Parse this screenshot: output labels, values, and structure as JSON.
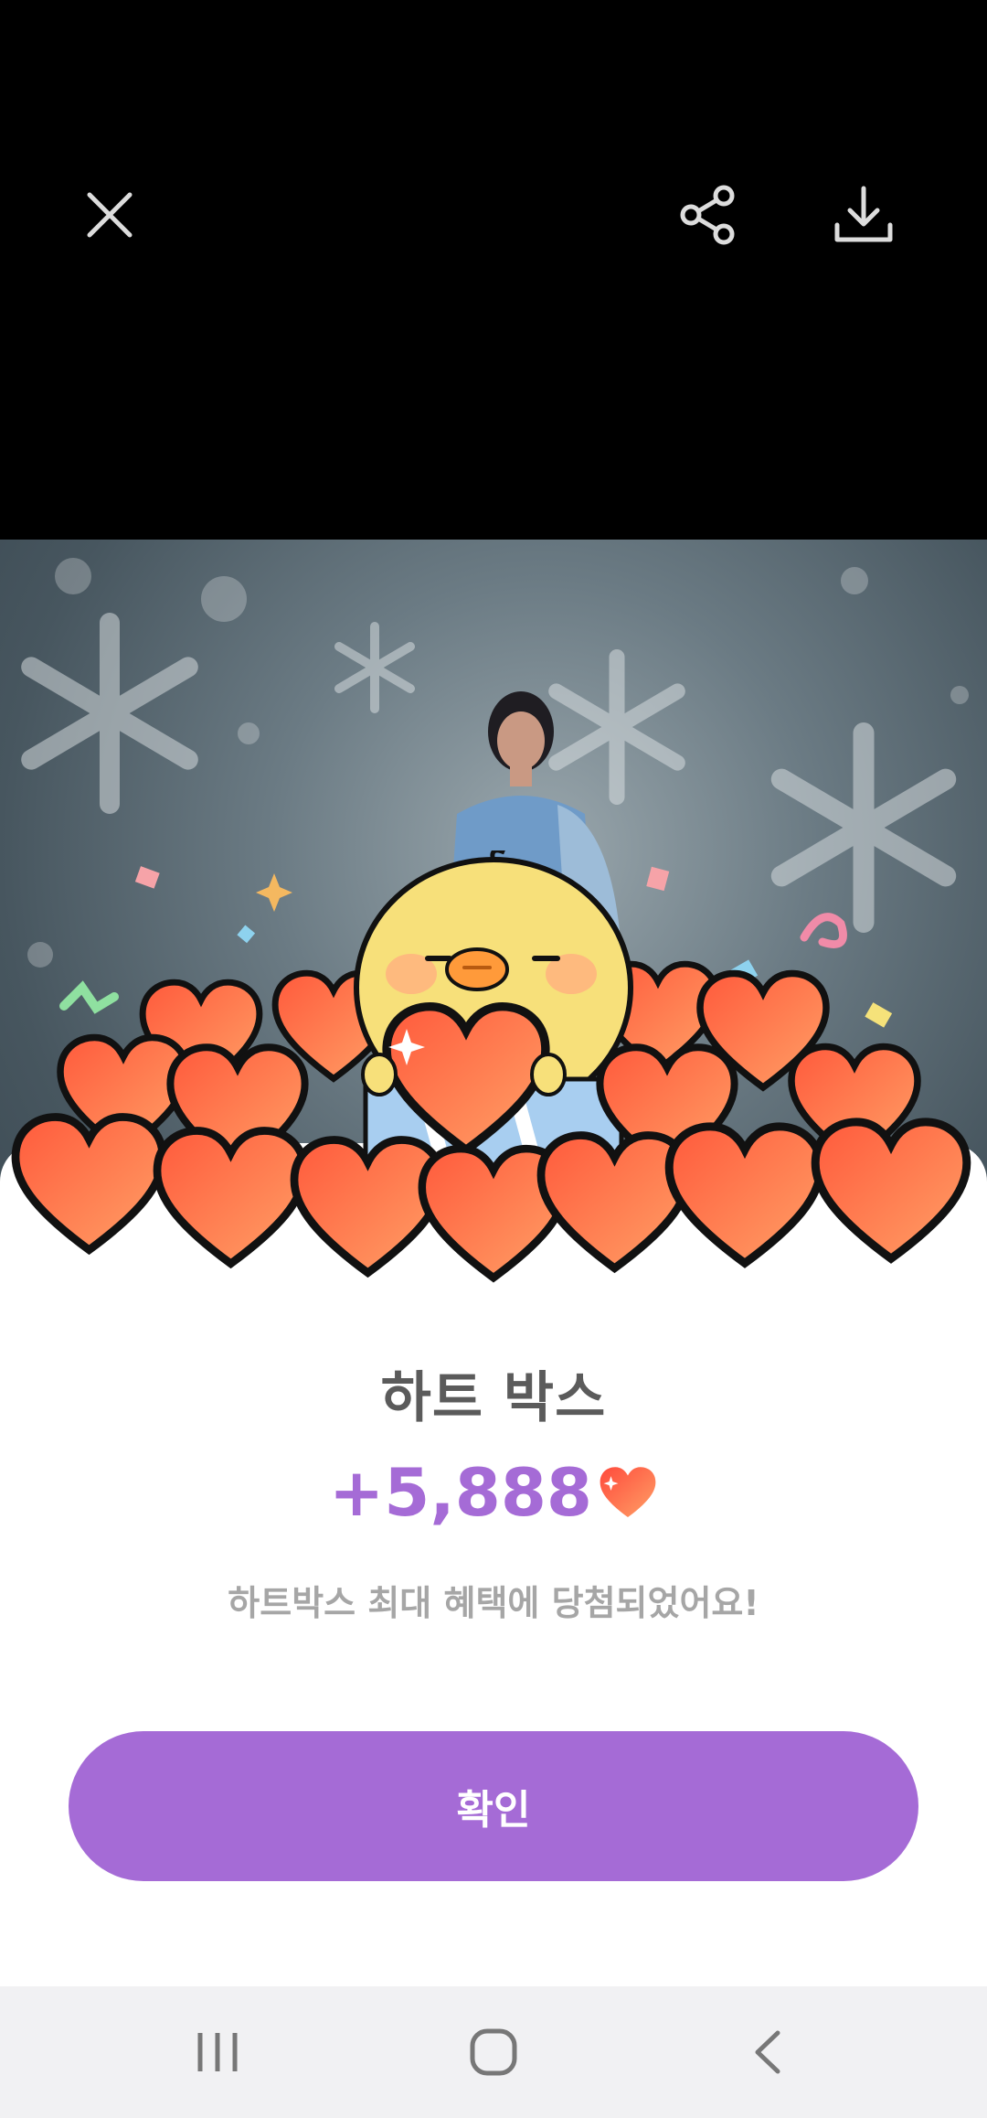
{
  "top_bar": {
    "close_icon": "close-icon",
    "share_icon": "share-icon",
    "download_icon": "download-icon"
  },
  "dialog": {
    "title": "하트 박스",
    "amount": "+5,888",
    "amount_icon": "heart-icon",
    "message": "하트박스 최대 혜택에 당첨되었어요!",
    "confirm_label": "확인",
    "accent_color": "#a56bd6"
  },
  "nav_bar": {
    "recent_icon": "recent-apps-icon",
    "home_icon": "home-icon",
    "back_icon": "back-icon"
  }
}
